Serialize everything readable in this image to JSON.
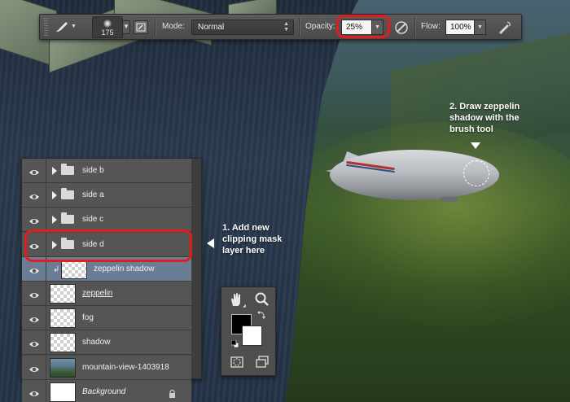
{
  "options_bar": {
    "brush_size": "175",
    "mode_label": "Mode:",
    "mode_value": "Normal",
    "opacity_label": "Opacity:",
    "opacity_value": "25%",
    "flow_label": "Flow:",
    "flow_value": "100%"
  },
  "annotations": {
    "step1": "1. Add new\nclipping mask\nlayer here",
    "step2": "2. Draw zeppelin\nshadow with the\nbrush tool"
  },
  "layers": {
    "items": [
      {
        "name": "side b",
        "type": "group",
        "visible": true
      },
      {
        "name": "side a",
        "type": "group",
        "visible": true
      },
      {
        "name": "side c",
        "type": "group",
        "visible": true
      },
      {
        "name": "side d",
        "type": "group",
        "visible": true
      },
      {
        "name": "zeppelin shadow",
        "type": "layer",
        "visible": true,
        "selected": true,
        "clipping": true
      },
      {
        "name": "zeppelin",
        "type": "layer",
        "visible": true,
        "underlined": true
      },
      {
        "name": "fog",
        "type": "layer",
        "visible": true
      },
      {
        "name": "shadow",
        "type": "layer",
        "visible": true
      },
      {
        "name": "mountain-view-1403918",
        "type": "layer",
        "visible": true
      },
      {
        "name": "Background",
        "type": "layer",
        "visible": true,
        "locked": true,
        "italic": true
      }
    ]
  },
  "colors": {
    "highlight_ring": "#e41c1c",
    "selected_layer": "#6b7d94",
    "foreground": "#000000",
    "background": "#ffffff"
  },
  "icons": [
    "brush-icon",
    "toggle-brush-panel-icon",
    "airbrush-icon",
    "pressure-size-icon",
    "eye-icon",
    "folder-icon",
    "lock-icon",
    "hand-tool-icon",
    "zoom-tool-icon",
    "swap-colors-icon",
    "default-colors-icon",
    "quick-mask-icon",
    "screen-mode-icon"
  ]
}
